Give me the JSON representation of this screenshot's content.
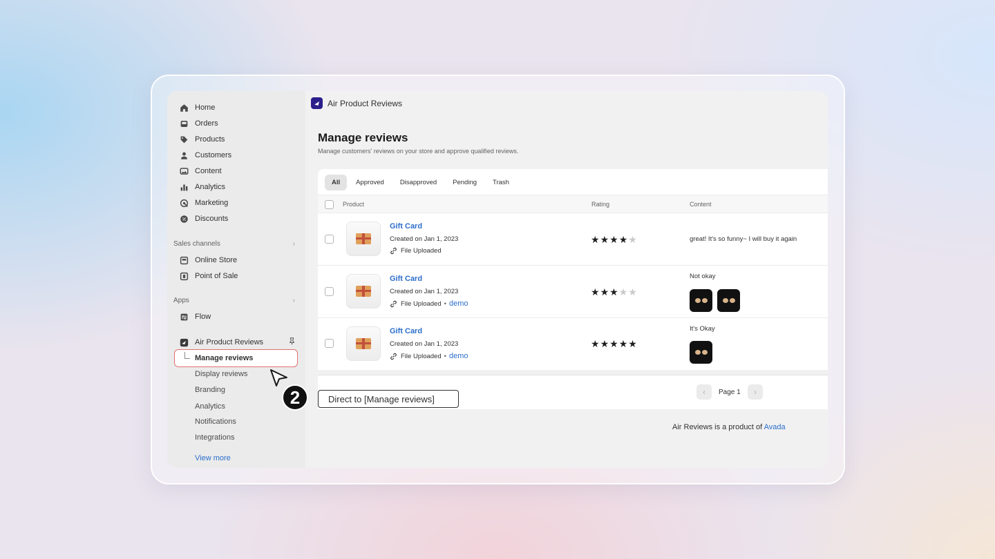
{
  "sidebar": {
    "items": [
      {
        "label": "Home",
        "icon": "home-icon"
      },
      {
        "label": "Orders",
        "icon": "inbox-icon"
      },
      {
        "label": "Products",
        "icon": "tag-icon"
      },
      {
        "label": "Customers",
        "icon": "person-icon"
      },
      {
        "label": "Content",
        "icon": "image-icon"
      },
      {
        "label": "Analytics",
        "icon": "bar-chart-icon"
      },
      {
        "label": "Marketing",
        "icon": "target-icon"
      },
      {
        "label": "Discounts",
        "icon": "discount-icon"
      }
    ],
    "sales_channels_label": "Sales channels",
    "sales_channels": [
      {
        "label": "Online Store",
        "icon": "store-icon"
      },
      {
        "label": "Point of Sale",
        "icon": "pos-icon"
      }
    ],
    "apps_label": "Apps",
    "apps": [
      {
        "label": "Flow",
        "icon": "flow-icon"
      }
    ],
    "app_name": "Air Product Reviews",
    "app_subitems": {
      "manage": "Manage reviews",
      "display": "Display reviews",
      "branding": "Branding",
      "analytics": "Analytics",
      "notifications": "Notifications",
      "integrations": "Integrations"
    },
    "view_more": "View more"
  },
  "header": {
    "app_title": "Air Product Reviews"
  },
  "page": {
    "title": "Manage reviews",
    "subtitle": "Manage customers' reviews on your store and approve qualified reviews."
  },
  "tabs": [
    "All",
    "Approved",
    "Disapproved",
    "Pending",
    "Trash"
  ],
  "columns": {
    "product": "Product",
    "rating": "Rating",
    "content": "Content"
  },
  "rows": [
    {
      "product": "Gift Card",
      "created": "Created on Jan 1, 2023",
      "file": "File Uploaded",
      "demo": "",
      "rating": 4,
      "content": "great! It's so funny~ I will buy it again",
      "media_count": 0
    },
    {
      "product": "Gift Card",
      "created": "Created on Jan 1, 2023",
      "file": "File Uploaded",
      "demo": "demo",
      "rating": 3,
      "content": "Not okay",
      "media_count": 2
    },
    {
      "product": "Gift Card",
      "created": "Created on Jan 1, 2023",
      "file": "File Uploaded",
      "demo": "demo",
      "rating": 5,
      "content": "It's Okay",
      "media_count": 1
    }
  ],
  "pagination": {
    "label": "Page 1"
  },
  "footer": {
    "text": "Air Reviews is a product of",
    "link": "Avada"
  },
  "annotation": {
    "step": "2",
    "tooltip": "Direct to [Manage reviews]"
  }
}
